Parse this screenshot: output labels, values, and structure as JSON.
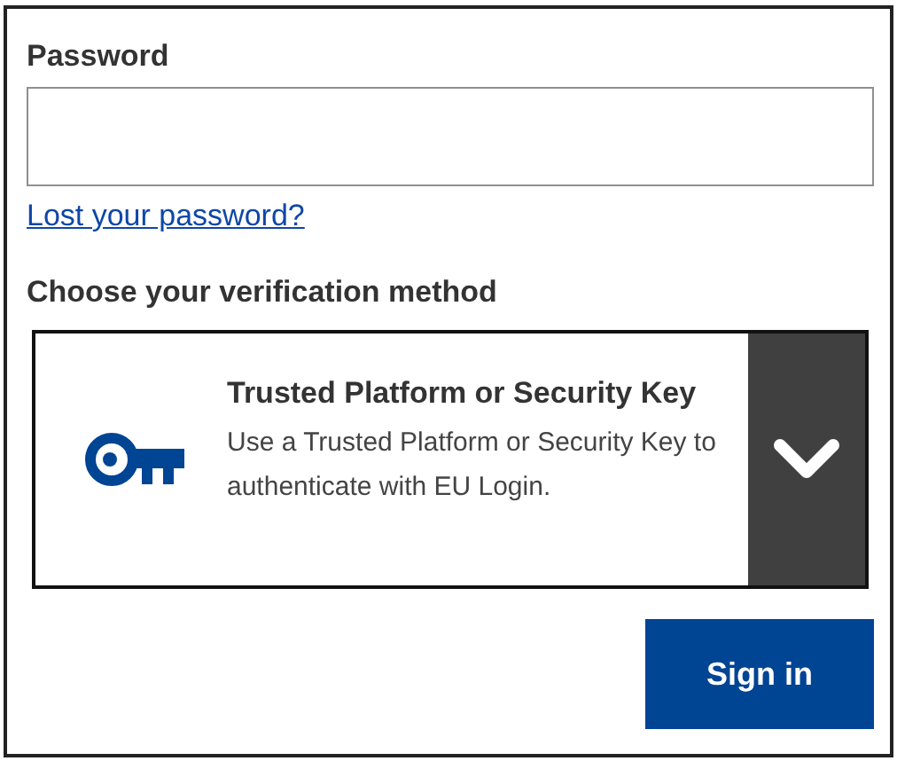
{
  "password": {
    "label": "Password"
  },
  "lost_password_link": "Lost your password?",
  "verification": {
    "heading": "Choose your verification method",
    "method": {
      "title": "Trusted Platform or Security Key",
      "description": "Use a Trusted Platform or Security Key to authenticate with EU Login."
    }
  },
  "sign_in_button": "Sign in"
}
